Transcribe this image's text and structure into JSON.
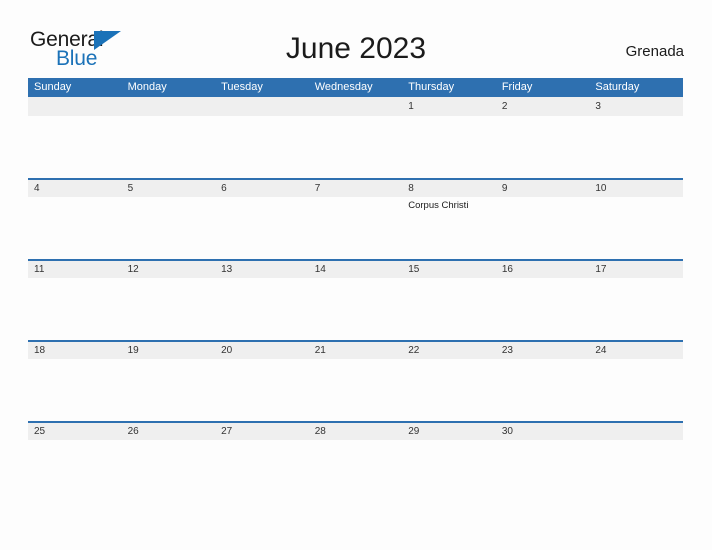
{
  "brand": {
    "name_part1": "General",
    "name_part2": "Blue",
    "accent_color": "#1b72b8"
  },
  "header": {
    "title": "June 2023",
    "region": "Grenada"
  },
  "theme": {
    "header_blue": "#2e70b0",
    "date_strip_gray": "#efefef",
    "page_background": "#fdfdfd"
  },
  "calendar": {
    "weekday_headers": [
      "Sunday",
      "Monday",
      "Tuesday",
      "Wednesday",
      "Thursday",
      "Friday",
      "Saturday"
    ],
    "weeks": [
      {
        "days": [
          {
            "date": "",
            "events": []
          },
          {
            "date": "",
            "events": []
          },
          {
            "date": "",
            "events": []
          },
          {
            "date": "",
            "events": []
          },
          {
            "date": "1",
            "events": []
          },
          {
            "date": "2",
            "events": []
          },
          {
            "date": "3",
            "events": []
          }
        ]
      },
      {
        "days": [
          {
            "date": "4",
            "events": []
          },
          {
            "date": "5",
            "events": []
          },
          {
            "date": "6",
            "events": []
          },
          {
            "date": "7",
            "events": []
          },
          {
            "date": "8",
            "events": [
              "Corpus Christi"
            ]
          },
          {
            "date": "9",
            "events": []
          },
          {
            "date": "10",
            "events": []
          }
        ]
      },
      {
        "days": [
          {
            "date": "11",
            "events": []
          },
          {
            "date": "12",
            "events": []
          },
          {
            "date": "13",
            "events": []
          },
          {
            "date": "14",
            "events": []
          },
          {
            "date": "15",
            "events": []
          },
          {
            "date": "16",
            "events": []
          },
          {
            "date": "17",
            "events": []
          }
        ]
      },
      {
        "days": [
          {
            "date": "18",
            "events": []
          },
          {
            "date": "19",
            "events": []
          },
          {
            "date": "20",
            "events": []
          },
          {
            "date": "21",
            "events": []
          },
          {
            "date": "22",
            "events": []
          },
          {
            "date": "23",
            "events": []
          },
          {
            "date": "24",
            "events": []
          }
        ]
      },
      {
        "days": [
          {
            "date": "25",
            "events": []
          },
          {
            "date": "26",
            "events": []
          },
          {
            "date": "27",
            "events": []
          },
          {
            "date": "28",
            "events": []
          },
          {
            "date": "29",
            "events": []
          },
          {
            "date": "30",
            "events": []
          },
          {
            "date": "",
            "events": []
          }
        ]
      }
    ]
  }
}
